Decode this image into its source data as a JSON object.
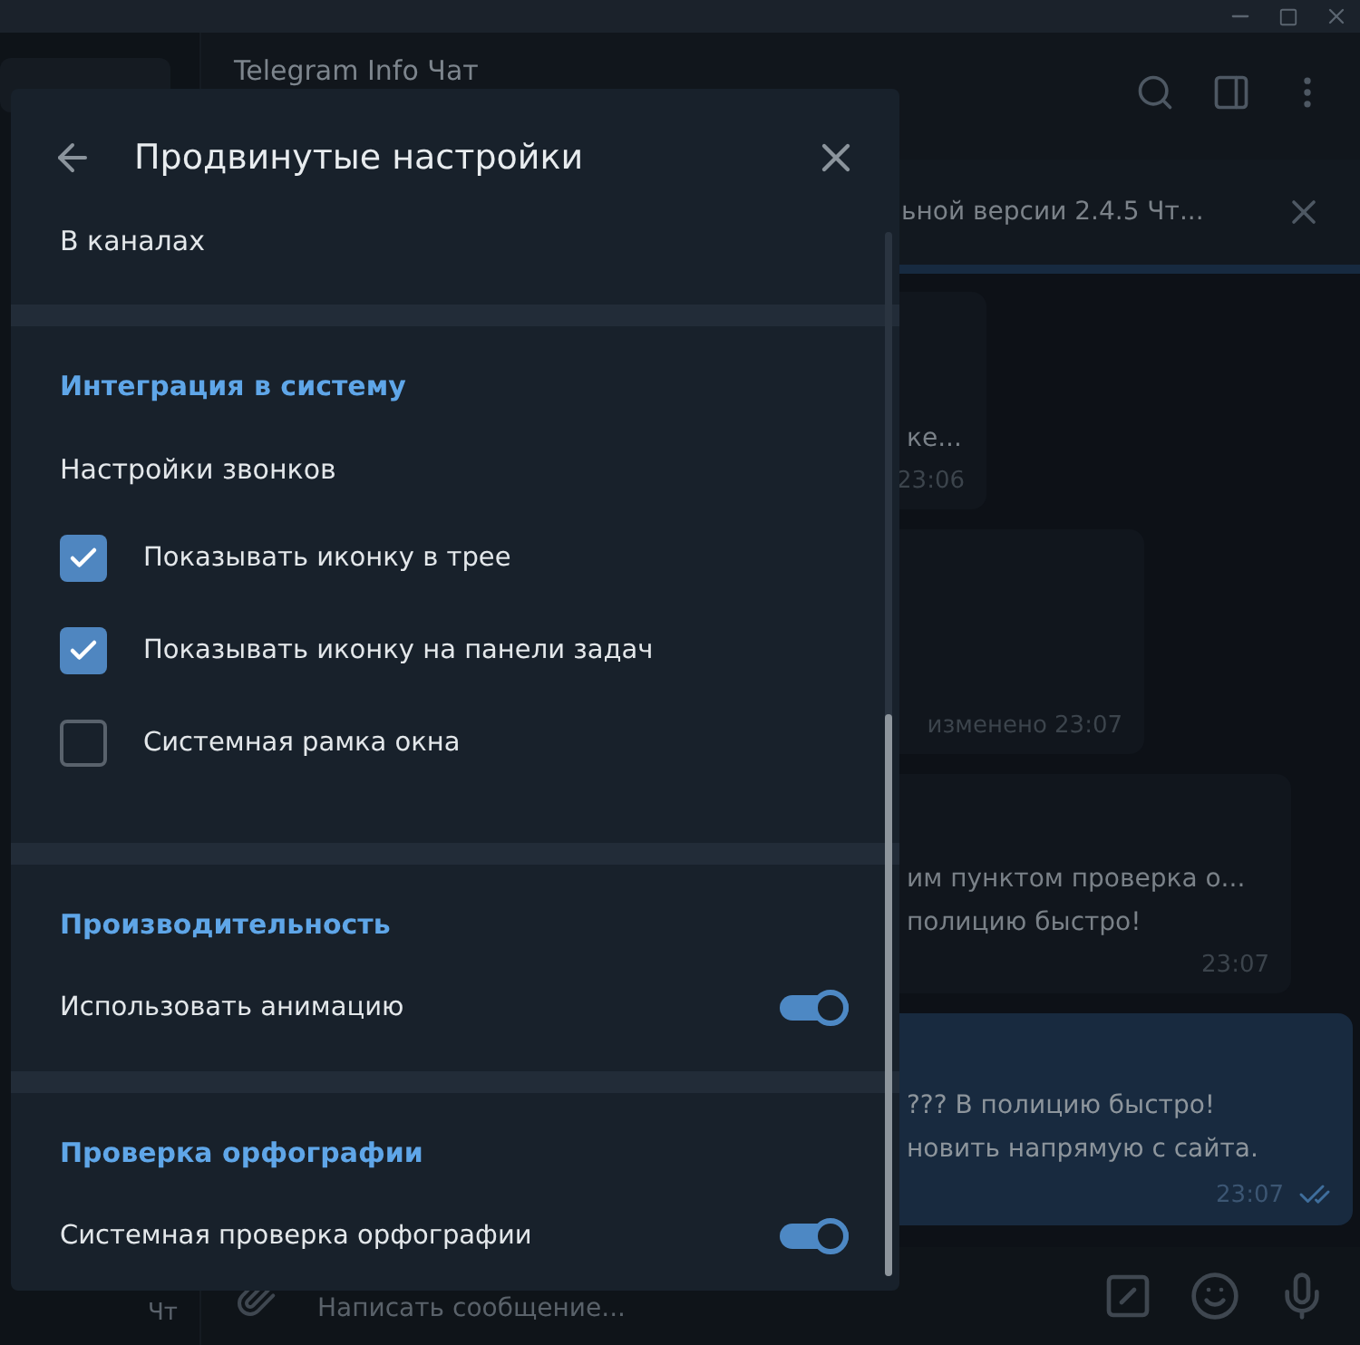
{
  "chat": {
    "title": "Telegram Info Чат",
    "pinned": {
      "text": "ьной версии 2.4.5  Чт..."
    },
    "messages": [
      {
        "kind": "incoming",
        "lines": [
          "ке..."
        ],
        "time": "23:06"
      },
      {
        "kind": "incoming",
        "time": "изменено 23:07"
      },
      {
        "kind": "incoming",
        "lines": [
          "им пунктом проверка о...",
          "полицию быстро!"
        ],
        "time": "23:07"
      },
      {
        "kind": "outgoing",
        "lines": [
          "??? В полицию быстро!",
          "новить напрямую с сайта."
        ],
        "time": "23:07",
        "read": true
      }
    ],
    "composer": {
      "placeholder": "Написать сообщение..."
    }
  },
  "sidebar": {
    "items": [
      {
        "time": "Чт"
      }
    ]
  },
  "dialog": {
    "title": "Продвинутые настройки",
    "sections": [
      {
        "items": [
          {
            "kind": "link",
            "label": "В каналах"
          }
        ]
      },
      {
        "title": "Интеграция в систему",
        "items": [
          {
            "kind": "link",
            "label": "Настройки звонков"
          },
          {
            "kind": "checkbox",
            "label": "Показывать иконку в трее",
            "checked": true
          },
          {
            "kind": "checkbox",
            "label": "Показывать иконку на панели задач",
            "checked": true
          },
          {
            "kind": "checkbox",
            "label": "Системная рамка окна",
            "checked": false
          }
        ]
      },
      {
        "title": "Производительность",
        "items": [
          {
            "kind": "toggle",
            "label": "Использовать анимацию",
            "on": true
          }
        ]
      },
      {
        "title": "Проверка орфографии",
        "items": [
          {
            "kind": "toggle",
            "label": "Системная проверка орфографии",
            "on": true
          }
        ]
      }
    ]
  }
}
